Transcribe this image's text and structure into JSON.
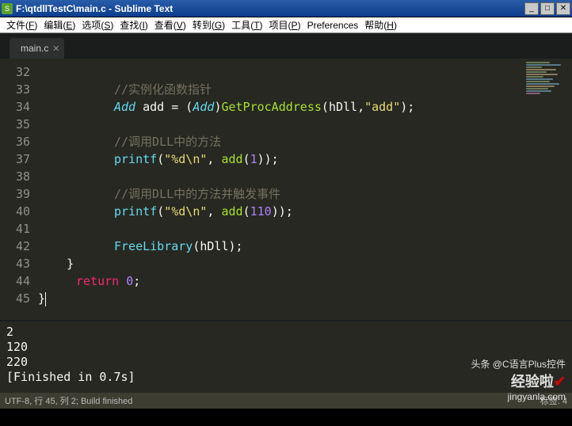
{
  "window": {
    "title": "F:\\qtdllTestC\\main.c - Sublime Text"
  },
  "menu": {
    "items": [
      {
        "label": "文件",
        "hk": "F"
      },
      {
        "label": "编辑",
        "hk": "E"
      },
      {
        "label": "选项",
        "hk": "S"
      },
      {
        "label": "查找",
        "hk": "I"
      },
      {
        "label": "查看",
        "hk": "V"
      },
      {
        "label": "转到",
        "hk": "G"
      },
      {
        "label": "工具",
        "hk": "T"
      },
      {
        "label": "项目",
        "hk": "P"
      },
      {
        "label": "Preferences",
        "hk": ""
      },
      {
        "label": "帮助",
        "hk": "H"
      }
    ]
  },
  "tabs": {
    "active": "main.c"
  },
  "gutter": {
    "start": 32,
    "end": 45
  },
  "code": {
    "l32": "",
    "l33_comment": "//实例化函数指针",
    "l34": {
      "type": "Add",
      "id": "add",
      "eq": " = (",
      "cast": "Add",
      "paren": ")",
      "fn": "GetProcAddress",
      "open": "(",
      "arg1": "hDll",
      "comma": ",",
      "str": "\"add\"",
      "close": ");"
    },
    "l35": "",
    "l36_comment": "//调用DLL中的方法",
    "l37": {
      "fn": "printf",
      "open": "(",
      "str": "\"%d\\n\"",
      "comma": ", ",
      "call": "add",
      "open2": "(",
      "num": "1",
      "close2": ")",
      ");": ");"
    },
    "l38": "",
    "l39_comment": "//调用DLL中的方法并触发事件",
    "l40": {
      "fn": "printf",
      "open": "(",
      "str": "\"%d\\n\"",
      "comma": ", ",
      "call": "add",
      "open2": "(",
      "num": "110",
      "close2": ")",
      ");": ");"
    },
    "l41": "",
    "l42": {
      "fn": "FreeLibrary",
      "open": "(",
      "arg": "hDll",
      "close": ");"
    },
    "l43": "    }",
    "l44": {
      "kw": "return",
      "sp": " ",
      "num": "0",
      "semi": ";"
    },
    "l45": "}"
  },
  "console": {
    "l1": "2",
    "l2": "120",
    "l3": "220",
    "l4": "[Finished in 0.7s]"
  },
  "status": {
    "left": "UTF-8, 行 45, 列 2; Build finished",
    "right": "标签: 4"
  },
  "watermark": {
    "line1": "头条 @C语言Plus控件",
    "logo1": "经验啦",
    "domain": "jingyanla.com"
  }
}
